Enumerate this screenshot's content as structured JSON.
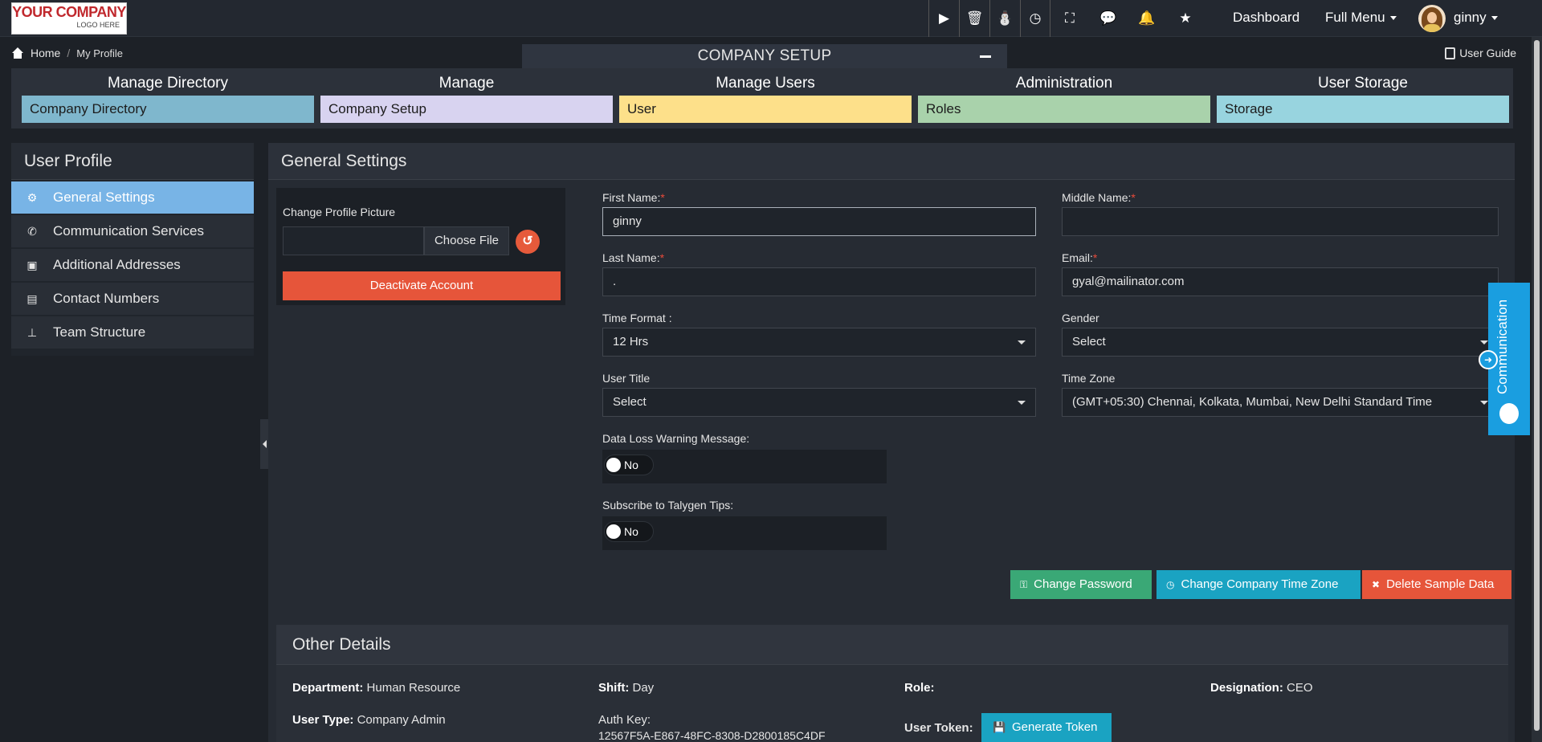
{
  "topbar": {
    "logo_line1": "YOUR COMPANY",
    "logo_line2": "LOGO HERE",
    "icons": [
      "play-icon",
      "trash-icon",
      "wizard-icon",
      "clock-icon",
      "fullscreen-icon",
      "chat-icon",
      "bell-icon",
      "star-icon"
    ],
    "dashboard": "Dashboard",
    "full_menu": "Full Menu",
    "user": "ginny"
  },
  "breadcrumb": {
    "home": "Home",
    "current": "My Profile",
    "separator": "/"
  },
  "setup_tab": "COMPANY SETUP",
  "user_guide": "User Guide",
  "modules": [
    {
      "title": "Manage Directory",
      "link": "Company Directory",
      "color": "#7fb7cd"
    },
    {
      "title": "Manage",
      "link": "Company Setup",
      "color": "#d8d3f0"
    },
    {
      "title": "Manage Users",
      "link": "User",
      "color": "#fde08a"
    },
    {
      "title": "Administration",
      "link": "Roles",
      "color": "#a9d2ab"
    },
    {
      "title": "User Storage",
      "link": "Storage",
      "color": "#98d4df"
    }
  ],
  "sidebar": {
    "title": "User Profile",
    "items": [
      {
        "label": "General Settings",
        "icon": "gears-icon"
      },
      {
        "label": "Communication Services",
        "icon": "phone-icon"
      },
      {
        "label": "Additional Addresses",
        "icon": "address-book-icon"
      },
      {
        "label": "Contact Numbers",
        "icon": "file-icon"
      },
      {
        "label": "Team Structure",
        "icon": "sitemap-icon"
      }
    ]
  },
  "main": {
    "title": "General Settings",
    "change_picture": "Change Profile Picture",
    "choose_file": "Choose File",
    "deactivate": "Deactivate Account",
    "fields": {
      "first_name": {
        "label": "First Name:",
        "value": "ginny"
      },
      "middle_name": {
        "label": "Middle Name:",
        "value": ""
      },
      "last_name": {
        "label": "Last Name:",
        "value": "."
      },
      "email": {
        "label": "Email:",
        "value": "gyal@mailinator.com"
      },
      "time_format": {
        "label": "Time Format :",
        "value": "12 Hrs"
      },
      "gender": {
        "label": "Gender",
        "value": "Select"
      },
      "user_title": {
        "label": "User Title",
        "value": "Select"
      },
      "time_zone": {
        "label": "Time Zone",
        "value": "(GMT+05:30) Chennai, Kolkata, Mumbai, New Delhi Standard Time"
      },
      "data_loss": {
        "label": "Data Loss Warning Message:",
        "value": "No"
      },
      "subscribe": {
        "label": "Subscribe to Talygen Tips:",
        "value": "No"
      }
    },
    "required_mark": "*",
    "buttons": {
      "change_password": "Change Password",
      "change_tz": "Change Company Time Zone",
      "delete_sample": "Delete Sample Data"
    }
  },
  "other_details": {
    "title": "Other Details",
    "department_label": "Department:",
    "department": "Human Resource",
    "shift_label": "Shift:",
    "shift": "Day",
    "role_label": "Role:",
    "role": "",
    "designation_label": "Designation:",
    "designation": "CEO",
    "user_type_label": "User Type:",
    "user_type": "Company Admin",
    "auth_key_label": "Auth Key:",
    "auth_key": "12567F5A-E867-48FC-8308-D2800185C4DF",
    "user_token_label": "User Token:",
    "generate_token": "Generate Token"
  },
  "communication_tab": "Communication",
  "colors": {
    "active_sidebar": "#78b4e6",
    "danger": "#e6553a",
    "success": "#3aa876",
    "info": "#1aa3c2",
    "comm": "#1a9ee0"
  }
}
